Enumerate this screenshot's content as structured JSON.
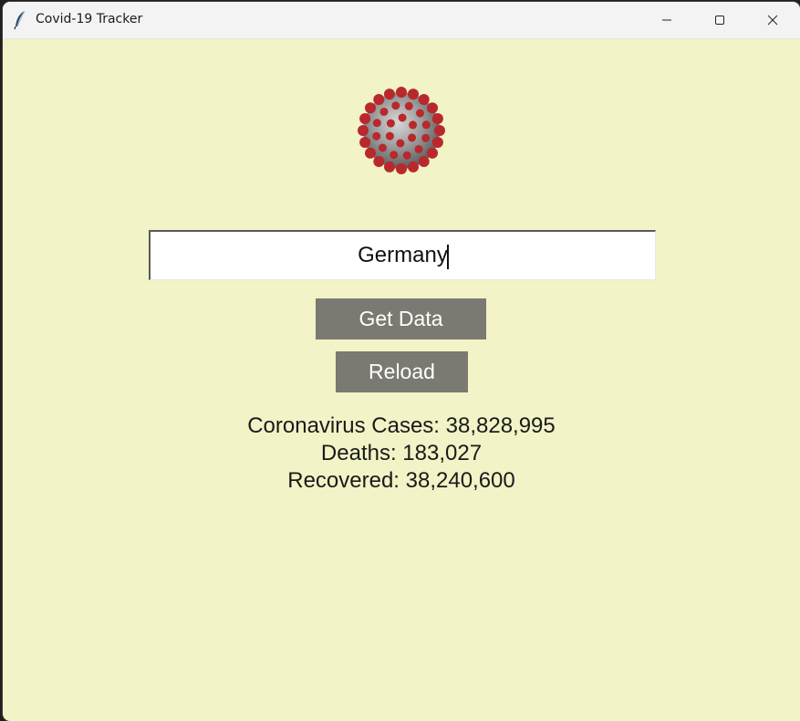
{
  "window": {
    "title": "Covid-19 Tracker",
    "icon": "feather-icon"
  },
  "controls": {
    "minimize": "minimize-icon",
    "maximize": "maximize-icon",
    "close": "close-icon"
  },
  "image": {
    "icon": "coronavirus-icon"
  },
  "search": {
    "value": "Germany"
  },
  "buttons": {
    "get_data": "Get Data",
    "reload": "Reload"
  },
  "results": {
    "cases": "Coronavirus Cases: 38,828,995",
    "deaths": "Deaths: 183,027",
    "recovered": "Recovered: 38,240,600"
  },
  "colors": {
    "background": "#f2f3c6",
    "button": "#7a7a72",
    "virus_spike": "#b8282c"
  }
}
